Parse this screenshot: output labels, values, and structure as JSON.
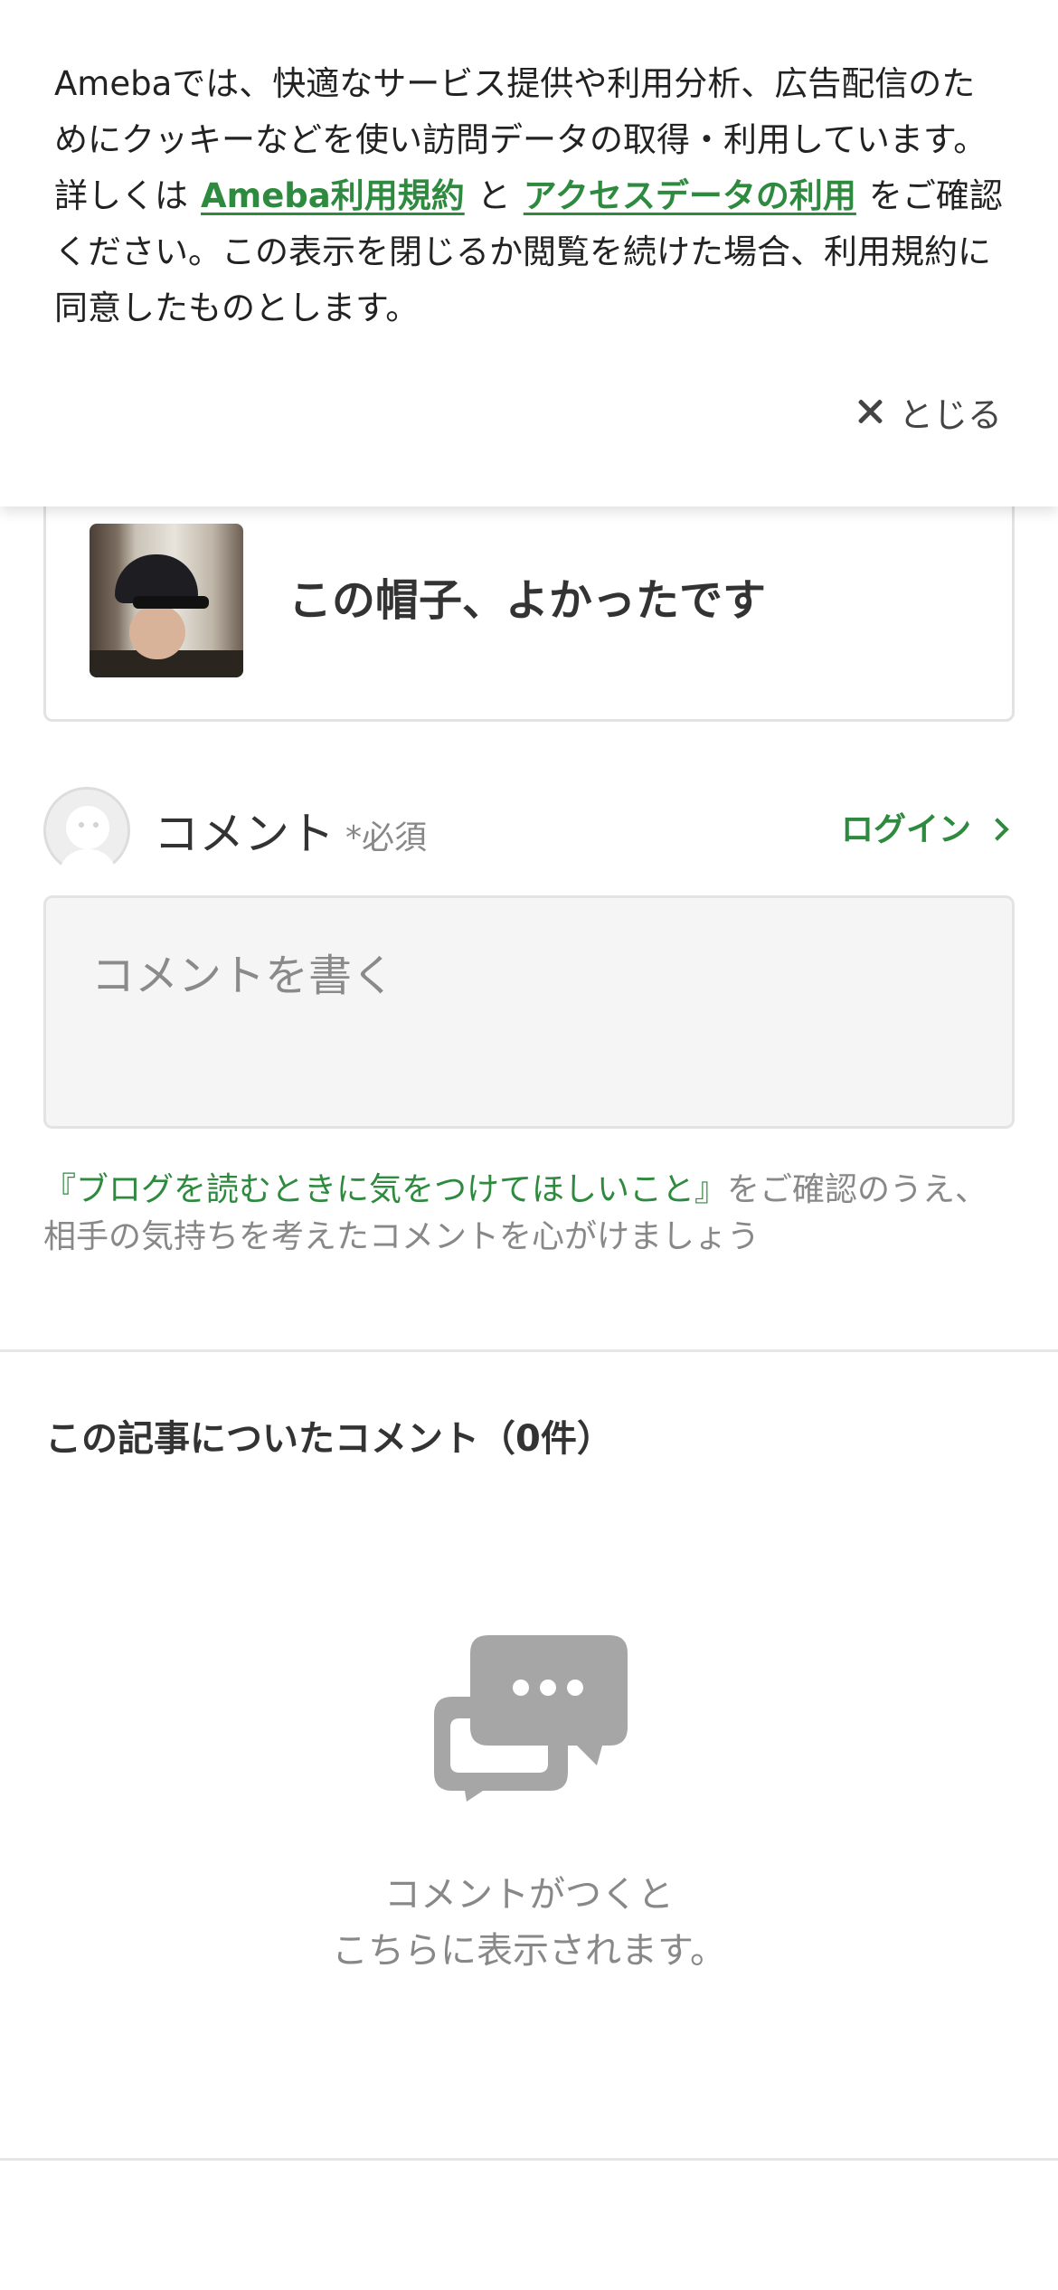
{
  "cookie_banner": {
    "text_before": "Amebaでは、快適なサービス提供や利用分析、広告配信のためにクッキーなどを使い訪問データの取得・利用しています。詳しくは",
    "link_terms": "Ameba利用規約",
    "text_and": "と",
    "link_access_data": "アクセスデータの利用",
    "text_after": "をご確認ください。この表示を閉じるか閲覧を続けた場合、利用規約に同意したものとします。",
    "close_label": "とじる",
    "close_icon": "close-icon"
  },
  "article": {
    "title": "この帽子、よかったです"
  },
  "comment_form": {
    "label": "コメント",
    "required": "*必須",
    "login": "ログイン",
    "placeholder": "コメントを書く",
    "guideline_link": "『ブログを読むときに気をつけてほしいこと』",
    "guideline_text": "をご確認のうえ、相手の気持ちを考えたコメントを心がけましょう"
  },
  "comments": {
    "title": "この記事についたコメント（0件）",
    "empty_line1": "コメントがつくと",
    "empty_line2": "こちらに表示されます。",
    "empty_icon": "chat-bubbles-icon"
  },
  "colors": {
    "accent": "#2d8a3e",
    "muted": "#888888",
    "icon_gray": "#a6a6a6"
  }
}
